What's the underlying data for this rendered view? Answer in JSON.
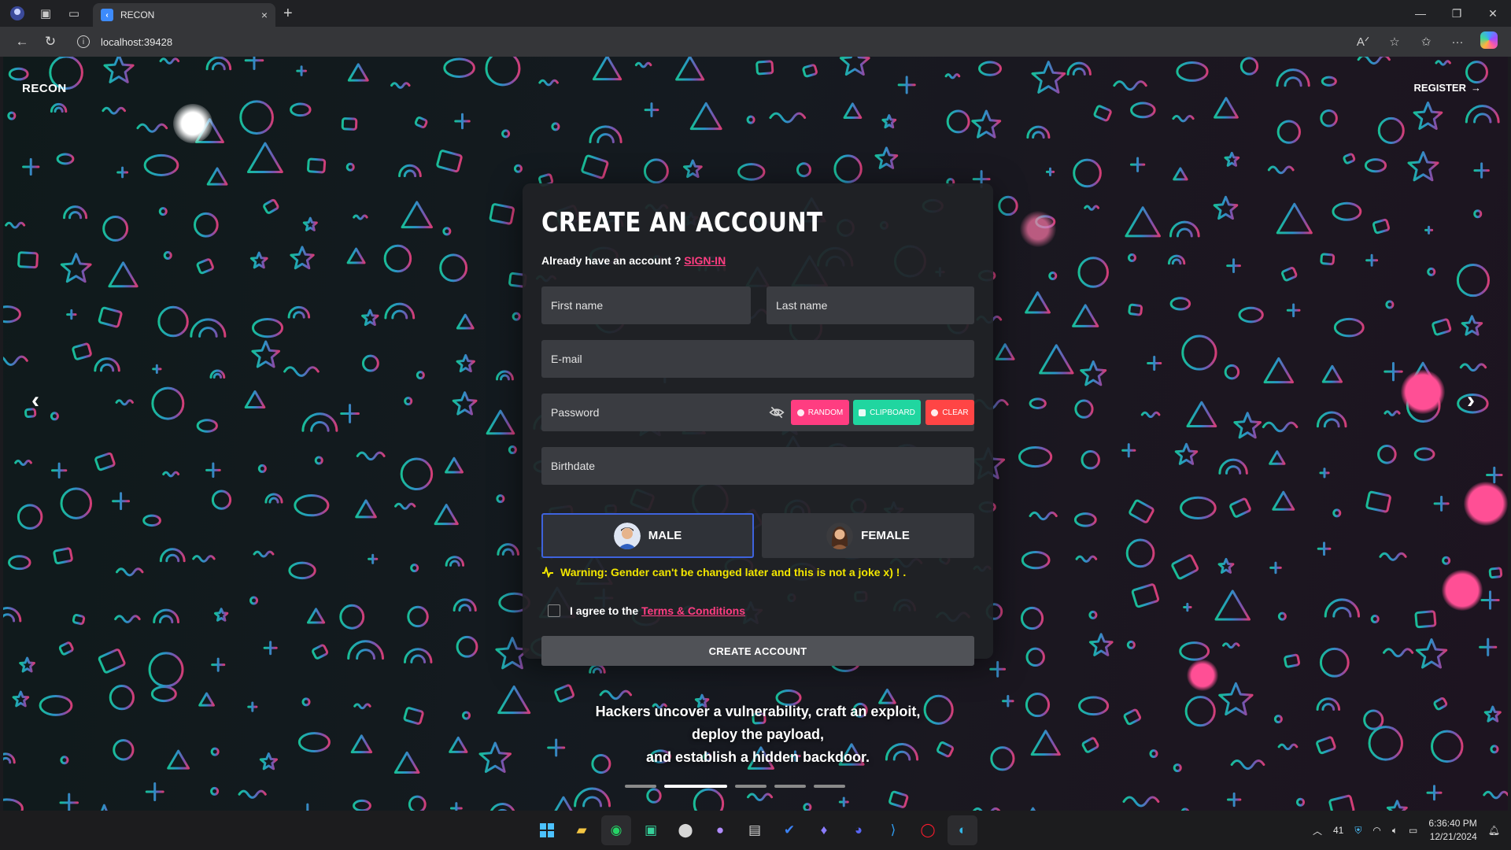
{
  "browser": {
    "tab_title": "RECON",
    "url": "localhost:39428",
    "close_tab": "×",
    "new_tab": "+"
  },
  "page": {
    "brand": "RECON",
    "register": "REGISTER",
    "register_arrow": "→",
    "prev_arrow": "‹",
    "next_arrow": "›"
  },
  "form": {
    "title": "CREATE AN ACCOUNT",
    "already_text": "Already have an account ?",
    "signin_link": "SIGN-IN",
    "first_name_placeholder": "First name",
    "last_name_placeholder": "Last name",
    "email_placeholder": "E-mail",
    "password_placeholder": "Password",
    "btn_random": "RANDOM",
    "btn_clipboard": "CLIPBOARD",
    "btn_clear": "CLEAR",
    "birthdate_placeholder": "Birthdate",
    "gender_male": "MALE",
    "gender_female": "FEMALE",
    "selected_gender": "MALE",
    "warning": "Warning: Gender can't be changed later and this is not a joke x) ! .",
    "agree_text": "I agree to the",
    "terms_link": "Terms & Conditions",
    "submit": "CREATE ACCOUNT"
  },
  "carousel": {
    "line1": "Hackers uncover a vulnerability, craft an exploit,",
    "line2": "deploy the payload,",
    "line3": "and establish a hidden backdoor.",
    "active_index": 1,
    "count": 5
  },
  "taskbar": {
    "tray_badge": "41",
    "time": "6:36:40 PM",
    "date": "12/21/2024"
  },
  "colors": {
    "accent_pink": "#ff3d81",
    "random_btn": "#ff3d81",
    "clipboard_btn": "#20d6a0",
    "clear_btn": "#ff4545",
    "warning": "#f2e600",
    "selected_border": "#3e63dd",
    "doodle_left": "#1bc79e",
    "doodle_right": "#e0407a"
  },
  "icons": {
    "eye": "eye-slash-icon",
    "warning": "pulse-icon",
    "register": "arrow-right-icon"
  }
}
